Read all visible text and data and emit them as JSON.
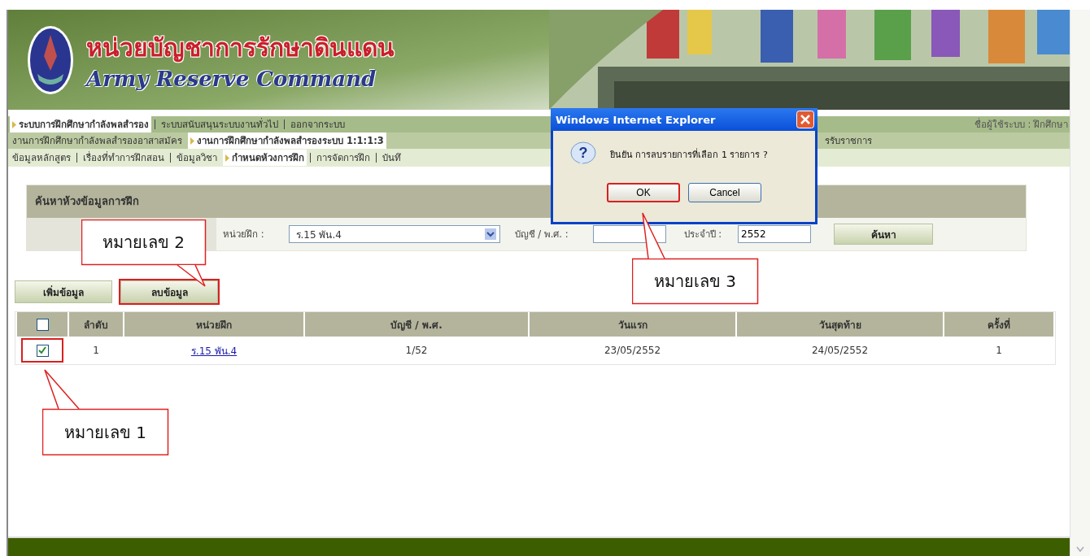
{
  "header": {
    "title": "หน่วยบัญชาการรักษาดินแดน",
    "subtitle": "Army Reserve Command"
  },
  "menu_rows": [
    {
      "items": [
        {
          "label": "ระบบการฝึกศึกษากำลังพลสำรอง",
          "selected": true
        },
        {
          "label": "ระบบสนับสนุนระบบงานทั่วไป",
          "selected": false
        },
        {
          "label": "ออกจากระบบ",
          "selected": false
        }
      ]
    },
    {
      "items": [
        {
          "label": "งานการฝึกศึกษากำลังพลสำรองอาสาสมัคร",
          "selected": false
        },
        {
          "label": "งานการฝึกศึกษากำลังพลสำรองระบบ 1:1:1:3",
          "selected": true
        }
      ],
      "trailing": "รรับราชการ"
    },
    {
      "items": [
        {
          "label": "ข้อมูลหลักสูตร",
          "selected": false
        },
        {
          "label": "เรื่องที่ทำการฝึกสอน",
          "selected": false
        },
        {
          "label": "ข้อมูลวิชา",
          "selected": false
        },
        {
          "label": "กำหนดห้วงการฝึก",
          "selected": true
        },
        {
          "label": "การจัดการฝึก",
          "selected": false
        },
        {
          "label": "บันทึ",
          "selected": false
        }
      ]
    }
  ],
  "user_label": "ชื่อผู้ใช้ระบบ : ฝึกศึกษา",
  "search_panel": {
    "title": "ค้นหาห้วงข้อมูลการฝึก",
    "unit_label": "หน่วยฝึก :",
    "unit_value": "ร.15 พัน.4",
    "account_label": "บัญชี / พ.ศ. :",
    "year_label": "ประจำปี :",
    "year_value": "2552",
    "search_button": "ค้นหา"
  },
  "buttons": [
    {
      "label": "เพิ่มข้อมูล",
      "highlighted": false
    },
    {
      "label": "ลบข้อมูล",
      "highlighted": true
    }
  ],
  "table": {
    "select_all_checked": false,
    "columns": [
      "ลำดับ",
      "หน่วยฝึก",
      "บัญชี / พ.ศ.",
      "วันแรก",
      "วันสุดท้าย",
      "ครั้งที่"
    ],
    "rows": [
      {
        "checked": true,
        "highlighted": true,
        "cells": [
          "1",
          "ร.15 พัน.4",
          "1/52",
          "23/05/2552",
          "24/05/2552",
          "1"
        ]
      }
    ]
  },
  "dialog": {
    "title": "Windows Internet Explorer",
    "icon_glyph": "?",
    "message": "ยินยัน การลบรายการที่เลือก 1 รายการ ?",
    "buttons": [
      {
        "label": "OK",
        "highlighted": true
      },
      {
        "label": "Cancel",
        "highlighted": false
      }
    ]
  },
  "callouts": [
    {
      "label": "หมายเลข 2"
    },
    {
      "label": "หมายเลข 3"
    },
    {
      "label": "หมายเลข 1"
    }
  ]
}
